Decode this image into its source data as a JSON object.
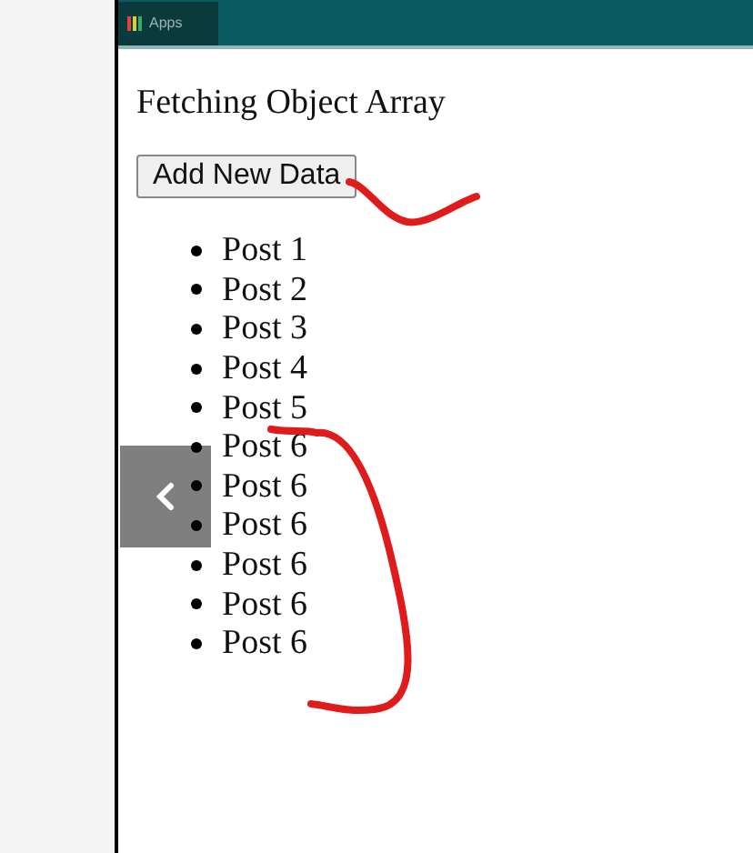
{
  "browser": {
    "bookmarks": [
      "Apps"
    ]
  },
  "page": {
    "title": "Fetching Object Array",
    "button": "Add New Data",
    "items": [
      "Post 1",
      "Post 2",
      "Post 3",
      "Post 4",
      "Post 5",
      "Post 6",
      "Post 6",
      "Post 6",
      "Post 6",
      "Post 6",
      "Post 6"
    ]
  }
}
